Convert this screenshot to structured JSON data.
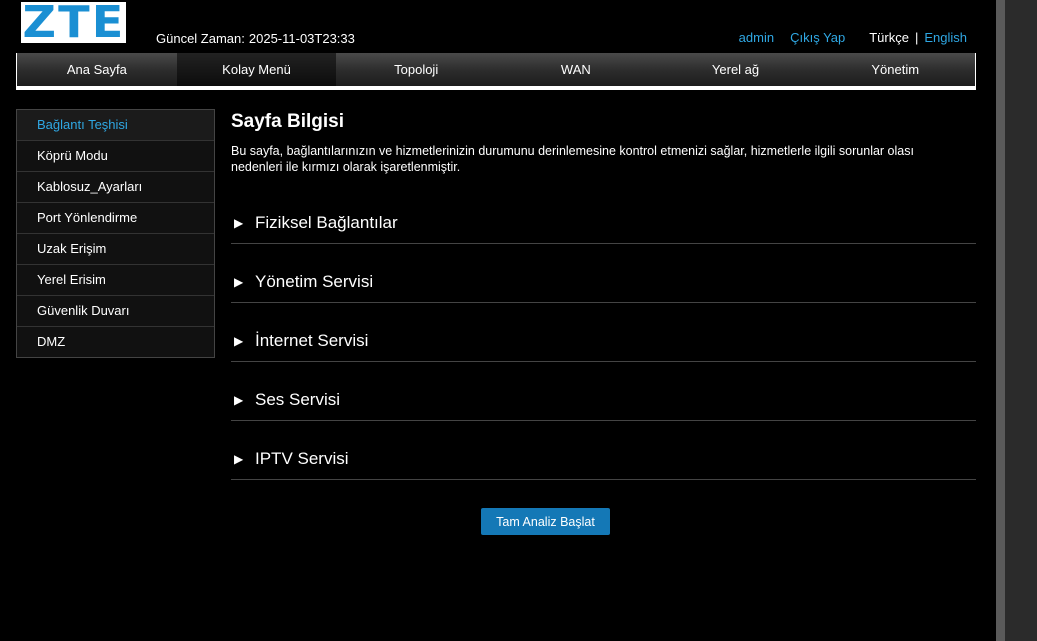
{
  "header": {
    "logo_text": "ZTE",
    "time_label": "Güncel Zaman:",
    "time_value": "2025-11-03T23:33",
    "user": "admin",
    "logout": "Çıkış Yap",
    "lang_current": "Türkçe",
    "lang_separator": "|",
    "lang_other": "English"
  },
  "nav": {
    "items": [
      "Ana Sayfa",
      "Kolay Menü",
      "Topoloji",
      "WAN",
      "Yerel ağ",
      "Yönetim"
    ],
    "active": "Kolay Menü"
  },
  "sidebar": {
    "items": [
      "Bağlantı Teşhisi",
      "Köprü Modu",
      "Kablosuz_Ayarları",
      "Port Yönlendirme",
      "Uzak Erişim",
      "Yerel Erisim",
      "Güvenlik Duvarı",
      "DMZ"
    ],
    "active": "Bağlantı Teşhisi"
  },
  "main": {
    "title": "Sayfa Bilgisi",
    "description": "Bu sayfa, bağlantılarınızın ve hizmetlerinizin durumunu derinlemesine kontrol etmenizi sağlar, hizmetlerle ilgili sorunlar olası nedenleri ile kırmızı olarak işaretlenmiştir.",
    "sections": [
      "Fiziksel Bağlantılar",
      "Yönetim Servisi",
      "İnternet Servisi",
      "Ses Servisi",
      "IPTV Servisi"
    ],
    "arrow_glyph": "▶",
    "button": "Tam Analiz Başlat"
  },
  "colors": {
    "accent": "#2fa7e3",
    "button": "#1478b6",
    "logo": "#1a8fd3"
  }
}
